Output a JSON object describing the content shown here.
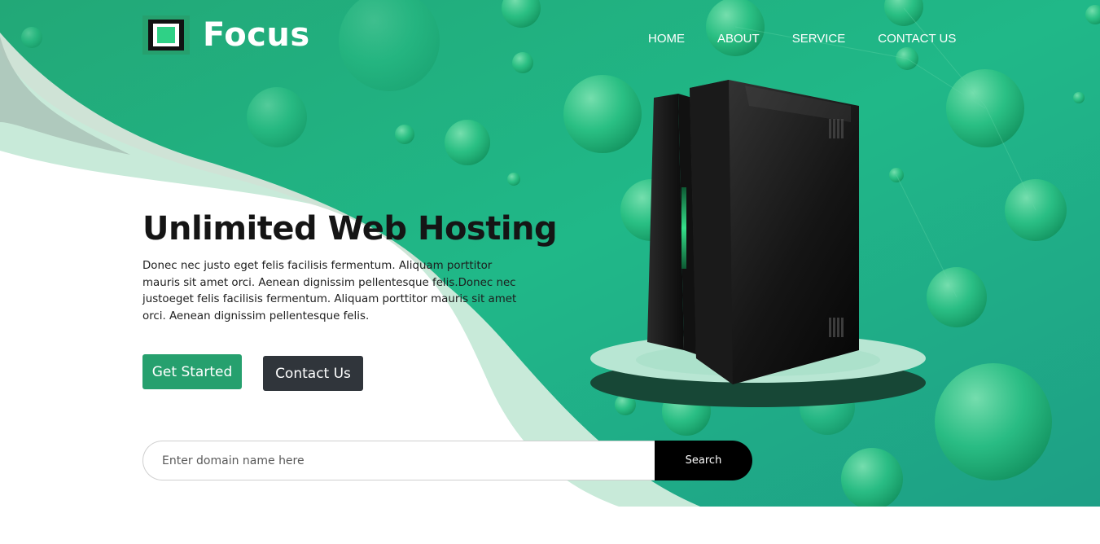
{
  "brand": {
    "name": "Focus",
    "accent": "#26a06e",
    "logo_icon": "square-frame-icon"
  },
  "nav": {
    "items": [
      "HOME",
      "ABOUT",
      "SERVICE",
      "CONTACT US"
    ]
  },
  "hero": {
    "title": "Unlimited Web Hosting",
    "description": "Donec nec justo eget felis facilisis fermentum. Aliquam porttitor mauris sit amet orci. Aenean dignissim pellentesque felis.Donec nec justoeget felis facilisis fermentum. Aliquam porttitor mauris sit amet orci. Aenean dignissim pellentesque felis.",
    "get_started_label": "Get Started",
    "contact_label": "Contact Us",
    "illustration": "server-tower-illustration"
  },
  "domain_search": {
    "placeholder": "Enter domain name here",
    "button_label": "Search"
  },
  "colors": {
    "hero_green": "#23b48a",
    "dark_button": "#30353b",
    "search_button": "#000000"
  }
}
